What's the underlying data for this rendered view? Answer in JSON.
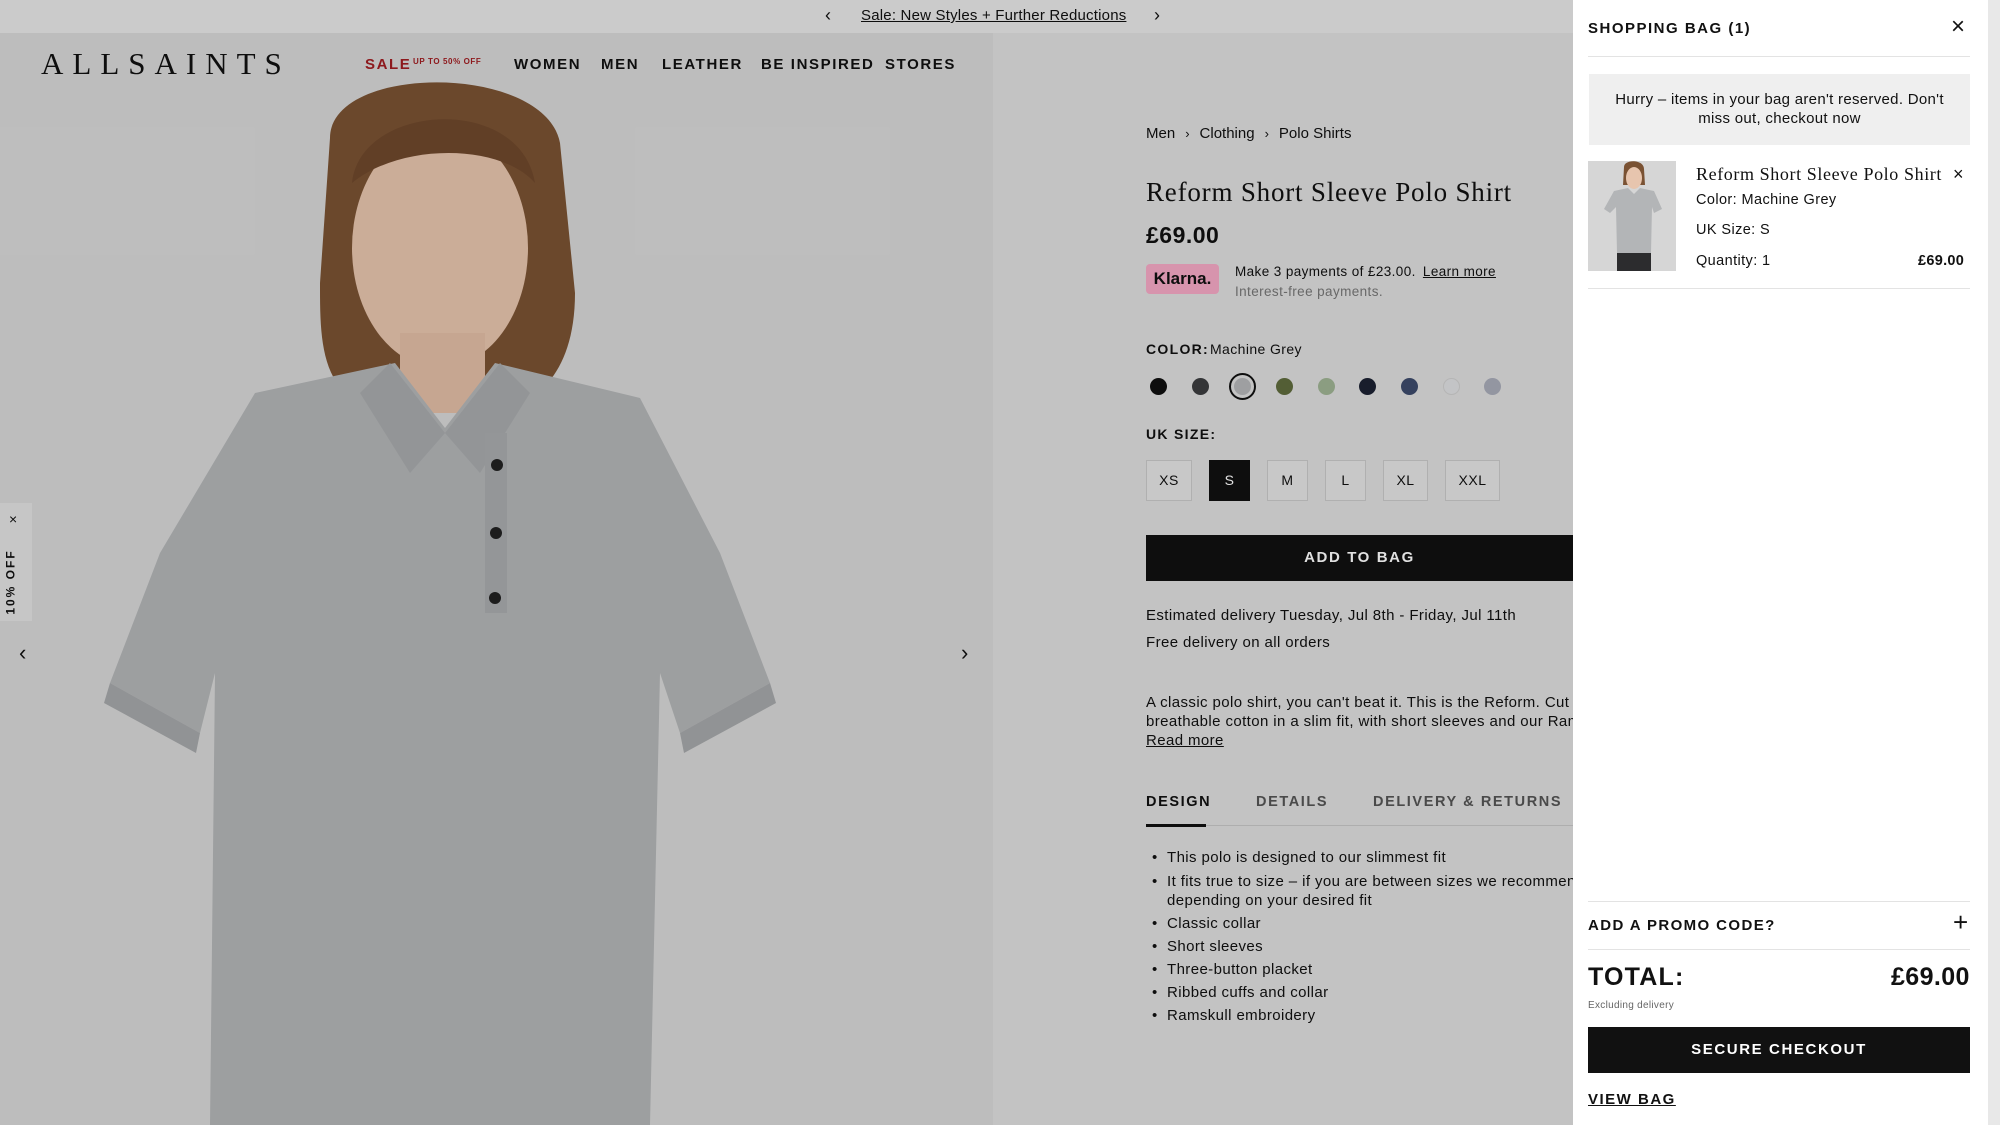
{
  "promo_bar": {
    "text": "Sale: New Styles + Further Reductions",
    "prev_icon": "‹",
    "next_icon": "›"
  },
  "header": {
    "logo": "ALLSAINTS",
    "nav": {
      "sale": "SALE",
      "sale_sup": "UP TO 50% OFF",
      "women": "WOMEN",
      "men": "MEN",
      "leather": "LEATHER",
      "be_inspired": "BE INSPIRED",
      "stores": "STORES"
    }
  },
  "side_tab": {
    "label": "10% OFF",
    "close": "×"
  },
  "gallery": {
    "prev": "‹",
    "next": "›"
  },
  "breadcrumb": [
    "Men",
    "Clothing",
    "Polo Shirts"
  ],
  "product": {
    "title": "Reform Short Sleeve Polo Shirt",
    "price": "£69.00",
    "klarna": {
      "badge": "Klarna.",
      "text": "Make 3 payments of £23.00.",
      "learn_more": "Learn more",
      "sub": "Interest-free payments."
    },
    "color_label": "COLOR:",
    "color_value": "Machine Grey",
    "swatches": [
      "#111111",
      "#3c3d3f",
      "#b4b6b8",
      "#5f6b3d",
      "#9fb393",
      "#1c2233",
      "#3d4b6b",
      "#dfe0e2",
      "#a8abb8"
    ],
    "selected_swatch": 2,
    "size_label": "UK SIZE:",
    "sizes": [
      "XS",
      "S",
      "M",
      "L",
      "XL",
      "XXL"
    ],
    "selected_size": "S",
    "add_to_bag": "ADD TO BAG",
    "delivery_estimate": "Estimated delivery Tuesday, Jul 8th - Friday, Jul 11th",
    "free_delivery": "Free delivery on all orders",
    "description_line1": "A classic polo shirt, you can't beat it. This is the Reform. Cut fr",
    "description_line2": "breathable cotton in a slim fit, with short sleeves and our Rams",
    "read_more": "Read more",
    "tabs": [
      "DESIGN",
      "DETAILS",
      "DELIVERY & RETURNS"
    ],
    "active_tab": "DESIGN",
    "design_bullets": [
      "This polo is designed to our slimmest fit",
      "It fits true to size – if you are between sizes we recommend s",
      "depending on your desired fit",
      "Classic collar",
      "Short sleeves",
      "Three-button placket",
      "Ribbed cuffs and collar",
      "Ramskull embroidery"
    ]
  },
  "bag": {
    "title": "SHOPPING BAG (1)",
    "close": "×",
    "hurry": "Hurry – items in your bag aren't reserved. Don't miss out, checkout now",
    "item": {
      "name": "Reform Short Sleeve Polo Shirt",
      "color": "Color: Machine Grey",
      "size": "UK Size: S",
      "quantity": "Quantity: 1",
      "price": "£69.00",
      "remove": "×"
    },
    "promo_label": "ADD A PROMO CODE?",
    "promo_icon": "+",
    "total_label": "TOTAL:",
    "total_value": "£69.00",
    "excluding": "Excluding delivery",
    "checkout": "SECURE CHECKOUT",
    "view_bag": "VIEW BAG"
  }
}
